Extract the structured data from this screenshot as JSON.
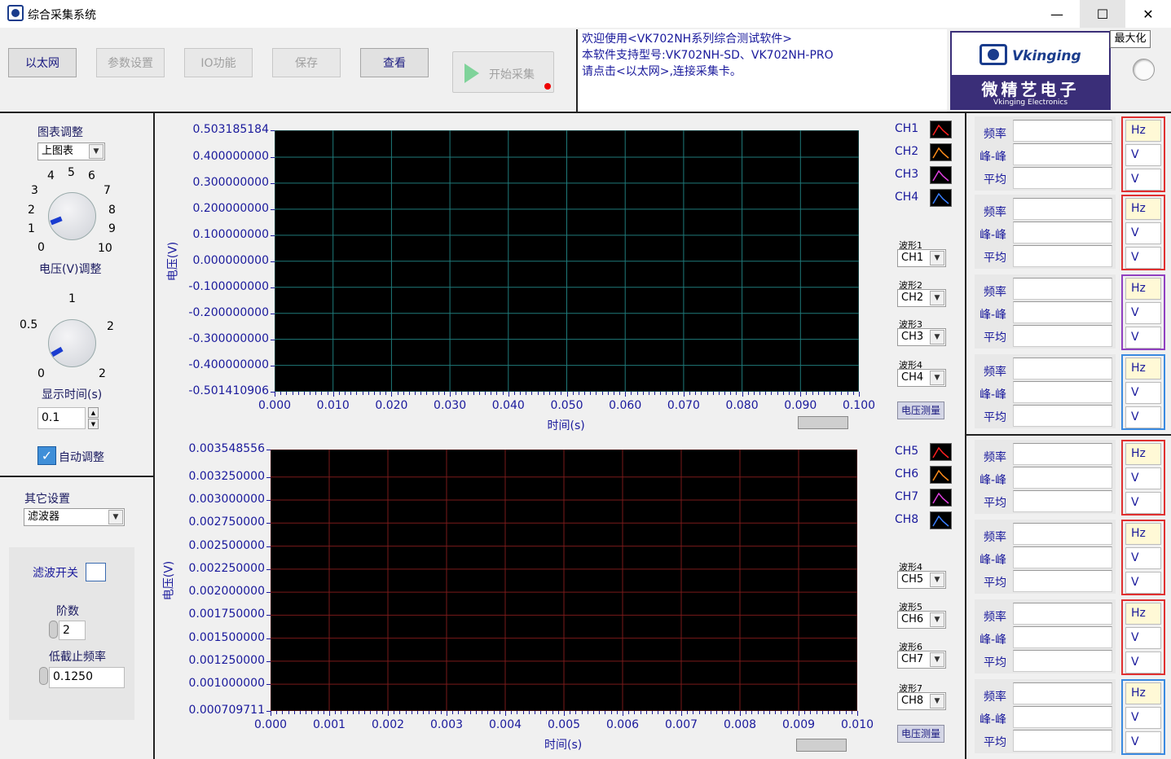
{
  "window": {
    "title": "综合采集系统",
    "minimize": "—",
    "maximize": "☐",
    "close": "✕",
    "tooltip": "最大化"
  },
  "toolbar": {
    "ethernet": "以太网",
    "params": "参数设置",
    "io": "IO功能",
    "save": "保存",
    "view": "查看",
    "start": "开始采集"
  },
  "info": {
    "line1": "欢迎使用<VK702NH系列综合测试软件>",
    "line2": "本软件支持型号:VK702NH-SD、VK702NH-PRO",
    "line3": "请点击<以太网>,连接采集卡。"
  },
  "logo": {
    "brand": "Vkinging",
    "cn": "微精艺电子",
    "en": "Vkinging Electronics"
  },
  "left": {
    "chart_adjust_label": "图表调整",
    "chart_select": "上图表",
    "voltage_label": "电压(V)调整",
    "voltage_ticks": [
      "0",
      "1",
      "2",
      "3",
      "4",
      "5",
      "6",
      "7",
      "8",
      "9",
      "10"
    ],
    "time_label": "显示时间(s)",
    "time_ticks": [
      "0",
      "0.5",
      "1",
      "2",
      "2"
    ],
    "time_value": "0.1",
    "auto_label": "自动调整",
    "other_label": "其它设置",
    "other_select": "滤波器",
    "filter_switch": "滤波开关",
    "order_label": "阶数",
    "order_value": "2",
    "cutoff_label": "低截止频率",
    "cutoff_value": "0.1250"
  },
  "chart_data": [
    {
      "type": "line",
      "title": "",
      "xlabel": "时间(s)",
      "ylabel": "电压(V)",
      "xlim": [
        0.0,
        0.1
      ],
      "ylim": [
        -0.501410906,
        0.503185184
      ],
      "x_ticks": [
        "0.000",
        "0.010",
        "0.020",
        "0.030",
        "0.040",
        "0.050",
        "0.060",
        "0.070",
        "0.080",
        "0.090",
        "0.100"
      ],
      "y_ticks": [
        "0.503185184",
        "0.400000000",
        "0.300000000",
        "0.200000000",
        "0.100000000",
        "0.000000000",
        "-0.100000000",
        "-0.200000000",
        "-0.300000000",
        "-0.400000000",
        "-0.501410906"
      ],
      "series": [
        {
          "name": "CH1",
          "color": "#ff2020",
          "values": []
        },
        {
          "name": "CH2",
          "color": "#ff8c1a",
          "values": []
        },
        {
          "name": "CH3",
          "color": "#e040e0",
          "values": []
        },
        {
          "name": "CH4",
          "color": "#3a7fff",
          "values": []
        }
      ],
      "grid_color": "#1f7a7a"
    },
    {
      "type": "line",
      "title": "",
      "xlabel": "时间(s)",
      "ylabel": "电压(V)",
      "xlim": [
        0.0,
        0.01
      ],
      "ylim": [
        0.000709711,
        0.003548556
      ],
      "x_ticks": [
        "0.000",
        "0.001",
        "0.002",
        "0.003",
        "0.004",
        "0.005",
        "0.006",
        "0.007",
        "0.008",
        "0.009",
        "0.010"
      ],
      "y_ticks": [
        "0.003548556",
        "0.003250000",
        "0.003000000",
        "0.002750000",
        "0.002500000",
        "0.002250000",
        "0.002000000",
        "0.001750000",
        "0.001500000",
        "0.001250000",
        "0.001000000",
        "0.000709711"
      ],
      "series": [
        {
          "name": "CH5",
          "color": "#ff2020",
          "values": []
        },
        {
          "name": "CH6",
          "color": "#ff8c1a",
          "values": []
        },
        {
          "name": "CH7",
          "color": "#e040e0",
          "values": []
        },
        {
          "name": "CH8",
          "color": "#3a7fff",
          "values": []
        }
      ],
      "grid_color": "#7a1a1a"
    }
  ],
  "waveforms_top": [
    {
      "label": "波形1",
      "value": "CH1"
    },
    {
      "label": "波形2",
      "value": "CH2"
    },
    {
      "label": "波形3",
      "value": "CH3"
    },
    {
      "label": "波形4",
      "value": "CH4"
    }
  ],
  "waveforms_bottom": [
    {
      "label": "波形4",
      "value": "CH5"
    },
    {
      "label": "波形5",
      "value": "CH6"
    },
    {
      "label": "波形6",
      "value": "CH7"
    },
    {
      "label": "波形7",
      "value": "CH8"
    }
  ],
  "measure_button": "电压测量",
  "measure": {
    "freq": "频率",
    "pp": "峰-峰",
    "avg": "平均",
    "unit_hz": "Hz",
    "unit_v": "V",
    "colors": [
      "#e03030",
      "#e03030",
      "#9040c0",
      "#3a8ae0",
      "#e03030",
      "#e03030",
      "#e03030",
      "#3a8ae0"
    ]
  }
}
